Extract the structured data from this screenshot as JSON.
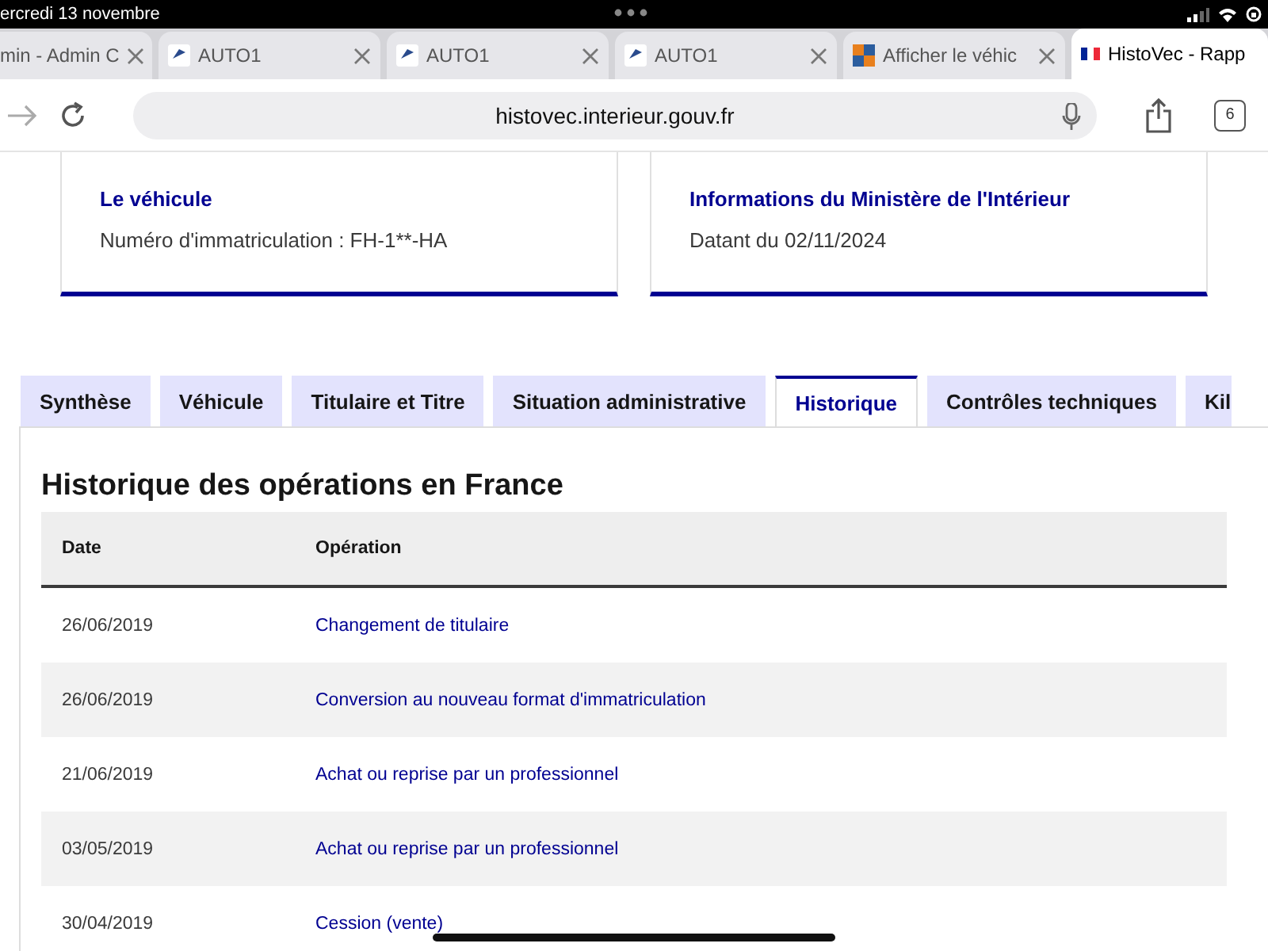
{
  "status_bar": {
    "date": "ercredi 13 novembre"
  },
  "browser_tabs": [
    {
      "title": "min - Admin C",
      "kind": "plain",
      "selected": false
    },
    {
      "title": "AUTO1",
      "kind": "auto",
      "selected": false
    },
    {
      "title": "AUTO1",
      "kind": "auto",
      "selected": false
    },
    {
      "title": "AUTO1",
      "kind": "auto",
      "selected": false
    },
    {
      "title": "Afficher le véhic",
      "kind": "squares",
      "selected": false
    },
    {
      "title": "HistoVec - Rapp",
      "kind": "flag",
      "selected": true
    }
  ],
  "address_bar": {
    "url": "histovec.interieur.gouv.fr",
    "tab_count": "6"
  },
  "cards": [
    {
      "title": "Le véhicule",
      "text": "Numéro d'immatriculation : FH-1**-HA"
    },
    {
      "title": "Informations du Ministère de l'Intérieur",
      "text": "Datant du 02/11/2024"
    }
  ],
  "page_tabs": [
    {
      "label": "Synthèse",
      "selected": false
    },
    {
      "label": "Véhicule",
      "selected": false
    },
    {
      "label": "Titulaire et Titre",
      "selected": false
    },
    {
      "label": "Situation administrative",
      "selected": false
    },
    {
      "label": "Historique",
      "selected": true
    },
    {
      "label": "Contrôles techniques",
      "selected": false
    },
    {
      "label": "Kil",
      "selected": false
    }
  ],
  "section_title": "Historique des opérations en France",
  "table": {
    "columns": [
      "Date",
      "Opération"
    ],
    "rows": [
      {
        "date": "26/06/2019",
        "operation": "Changement de titulaire"
      },
      {
        "date": "26/06/2019",
        "operation": "Conversion au nouveau format d'immatriculation"
      },
      {
        "date": "21/06/2019",
        "operation": "Achat ou reprise par un professionnel"
      },
      {
        "date": "03/05/2019",
        "operation": "Achat ou reprise par un professionnel"
      },
      {
        "date": "30/04/2019",
        "operation": "Cession (vente)"
      }
    ]
  }
}
